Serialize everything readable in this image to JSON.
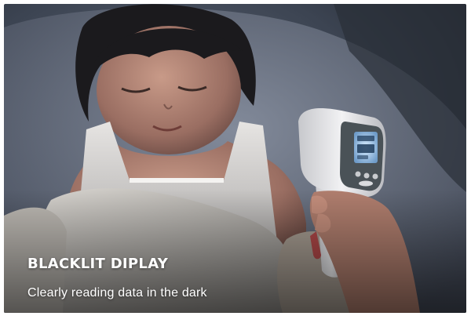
{
  "caption": {
    "title": "BLACKLIT DIPLAY",
    "subtitle": "Clearly reading data in the dark"
  },
  "thermometer": {
    "display_glyph": "temperature-display",
    "screen_color": "#a8c8e6",
    "body_color": "#e8e8ea"
  },
  "colors": {
    "background": "#3a4250",
    "caption_text": "#ffffff"
  }
}
